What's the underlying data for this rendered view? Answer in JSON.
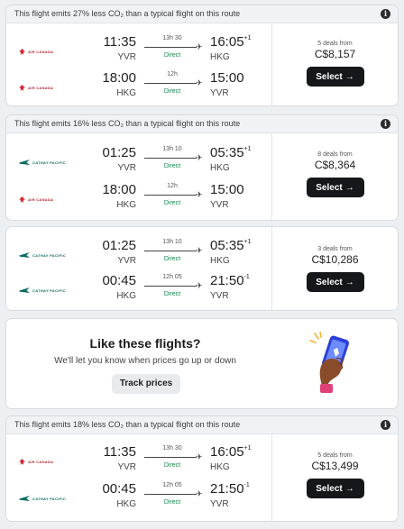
{
  "results": [
    {
      "banner": "This flight emits 27% less CO₂ than a typical flight on this route",
      "legs": [
        {
          "airline": "AIR CANADA",
          "airline_logo": "air-canada-leaf-icon",
          "dep_time": "11:35",
          "dep_code": "YVR",
          "duration": "13h 30",
          "stops": "Direct",
          "arr_time": "16:05",
          "arr_day_offset": "+1",
          "arr_code": "HKG"
        },
        {
          "airline": "AIR CANADA",
          "airline_logo": "air-canada-leaf-icon",
          "dep_time": "18:00",
          "dep_code": "HKG",
          "duration": "12h",
          "stops": "Direct",
          "arr_time": "15:00",
          "arr_day_offset": "",
          "arr_code": "YVR"
        }
      ],
      "deals": "5 deals from",
      "price": "C$8,157",
      "select_label": "Select"
    },
    {
      "banner": "This flight emits 16% less CO₂ than a typical flight on this route",
      "legs": [
        {
          "airline": "CATHAY PACIFIC",
          "airline_logo": "cathay-wing-icon",
          "dep_time": "01:25",
          "dep_code": "YVR",
          "duration": "13h 10",
          "stops": "Direct",
          "arr_time": "05:35",
          "arr_day_offset": "+1",
          "arr_code": "HKG"
        },
        {
          "airline": "AIR CANADA",
          "airline_logo": "air-canada-leaf-icon",
          "dep_time": "18:00",
          "dep_code": "HKG",
          "duration": "12h",
          "stops": "Direct",
          "arr_time": "15:00",
          "arr_day_offset": "",
          "arr_code": "YVR"
        }
      ],
      "deals": "8 deals from",
      "price": "C$8,364",
      "select_label": "Select"
    },
    {
      "banner": "",
      "legs": [
        {
          "airline": "CATHAY PACIFIC",
          "airline_logo": "cathay-wing-icon",
          "dep_time": "01:25",
          "dep_code": "YVR",
          "duration": "13h 10",
          "stops": "Direct",
          "arr_time": "05:35",
          "arr_day_offset": "+1",
          "arr_code": "HKG"
        },
        {
          "airline": "CATHAY PACIFIC",
          "airline_logo": "cathay-wing-icon",
          "dep_time": "00:45",
          "dep_code": "HKG",
          "duration": "12h 05",
          "stops": "Direct",
          "arr_time": "21:50",
          "arr_day_offset": "-1",
          "arr_code": "YVR"
        }
      ],
      "deals": "3 deals from",
      "price": "C$10,286",
      "select_label": "Select"
    },
    {
      "banner": "This flight emits 18% less CO₂ than a typical flight on this route",
      "legs": [
        {
          "airline": "AIR CANADA",
          "airline_logo": "air-canada-leaf-icon",
          "dep_time": "11:35",
          "dep_code": "YVR",
          "duration": "13h 30",
          "stops": "Direct",
          "arr_time": "16:05",
          "arr_day_offset": "+1",
          "arr_code": "HKG"
        },
        {
          "airline": "CATHAY PACIFIC",
          "airline_logo": "cathay-wing-icon",
          "dep_time": "00:45",
          "dep_code": "HKG",
          "duration": "12h 05",
          "stops": "Direct",
          "arr_time": "21:50",
          "arr_day_offset": "-1",
          "arr_code": "YVR"
        }
      ],
      "deals": "5 deals from",
      "price": "C$13,499",
      "select_label": "Select"
    }
  ],
  "promo": {
    "title": "Like these flights?",
    "subtitle": "We'll let you know when prices go up or down",
    "button_label": "Track prices",
    "illustration": "hand-holding-phone-icon"
  },
  "icons": {
    "info": "info-icon",
    "plane": "plane-icon",
    "arrow": "arrow-right-icon"
  },
  "colors": {
    "select_button": "#15171a",
    "direct_text": "#118a4a",
    "air_canada_red": "#d22630",
    "cathay_green": "#0b6b5e"
  }
}
